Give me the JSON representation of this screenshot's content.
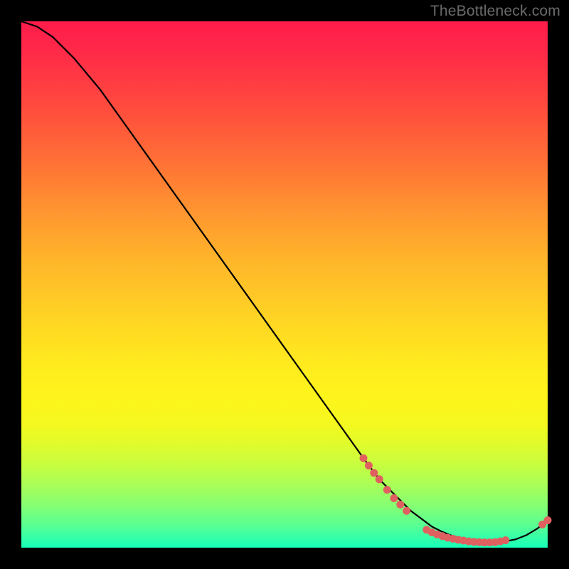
{
  "attribution": "TheBottleneck.com",
  "chart_data": {
    "type": "line",
    "title": "",
    "xlabel": "",
    "ylabel": "",
    "xlim": [
      0,
      100
    ],
    "ylim": [
      0,
      100
    ],
    "grid": false,
    "legend": false,
    "series": [
      {
        "name": "bottleneck-curve",
        "x": [
          0,
          3,
          6,
          10,
          15,
          20,
          30,
          40,
          50,
          60,
          65,
          68,
          70,
          72,
          74,
          76,
          78,
          80,
          82,
          84,
          86,
          88,
          90,
          92,
          94,
          96,
          98,
          99,
          100
        ],
        "y": [
          100,
          99,
          97,
          93,
          87,
          80,
          66,
          52,
          38,
          24,
          17,
          13,
          11,
          9,
          7,
          5.5,
          4,
          3,
          2.2,
          1.6,
          1.2,
          1.0,
          1.0,
          1.2,
          1.6,
          2.4,
          3.6,
          4.4,
          5.2
        ]
      }
    ],
    "markers": [
      {
        "x": 65.0,
        "y": 17.0
      },
      {
        "x": 66.0,
        "y": 15.6
      },
      {
        "x": 67.0,
        "y": 14.2
      },
      {
        "x": 68.0,
        "y": 13.0
      },
      {
        "x": 69.5,
        "y": 11.0
      },
      {
        "x": 70.8,
        "y": 9.4
      },
      {
        "x": 72.0,
        "y": 8.2
      },
      {
        "x": 73.2,
        "y": 7.0
      },
      {
        "x": 77.0,
        "y": 3.4
      },
      {
        "x": 78.0,
        "y": 2.9
      },
      {
        "x": 79.0,
        "y": 2.5
      },
      {
        "x": 80.0,
        "y": 2.2
      },
      {
        "x": 81.0,
        "y": 1.9
      },
      {
        "x": 82.0,
        "y": 1.7
      },
      {
        "x": 83.0,
        "y": 1.5
      },
      {
        "x": 84.0,
        "y": 1.35
      },
      {
        "x": 85.0,
        "y": 1.2
      },
      {
        "x": 86.0,
        "y": 1.1
      },
      {
        "x": 87.0,
        "y": 1.05
      },
      {
        "x": 88.0,
        "y": 1.0
      },
      {
        "x": 89.0,
        "y": 1.0
      },
      {
        "x": 90.0,
        "y": 1.05
      },
      {
        "x": 91.0,
        "y": 1.2
      },
      {
        "x": 92.0,
        "y": 1.4
      },
      {
        "x": 99.0,
        "y": 4.4
      },
      {
        "x": 100.0,
        "y": 5.2
      }
    ]
  }
}
